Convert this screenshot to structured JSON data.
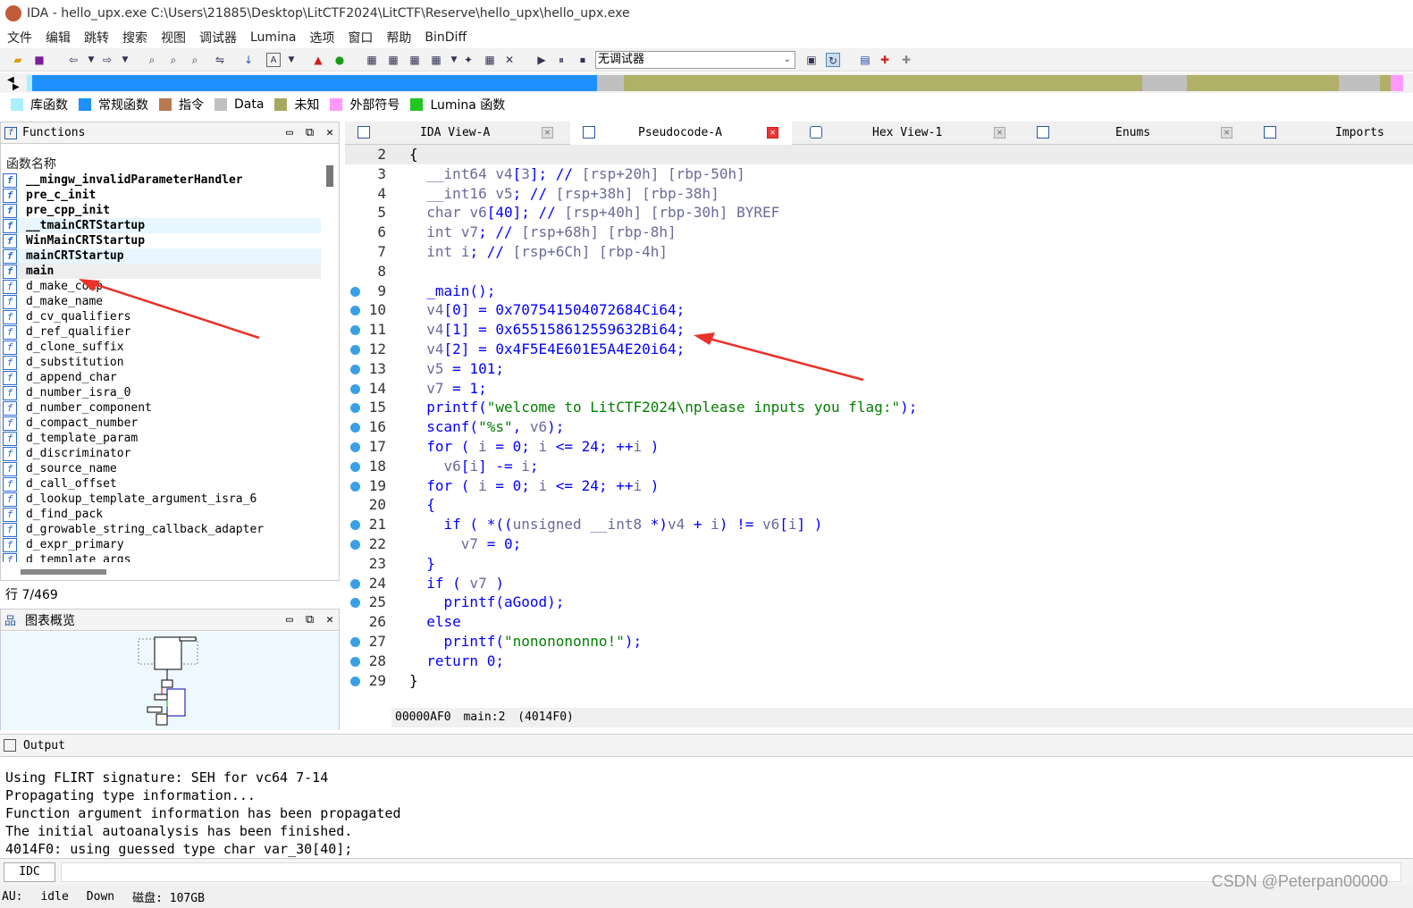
{
  "titlebar": {
    "title": "IDA - hello_upx.exe C:\\Users\\21885\\Desktop\\LitCTF2024\\LitCTF\\Reserve\\hello_upx\\hello_upx.exe"
  },
  "menu": [
    "文件",
    "编辑",
    "跳转",
    "搜索",
    "视图",
    "调试器",
    "Lumina",
    "选项",
    "窗口",
    "帮助",
    "BinDiff"
  ],
  "toolbar": {
    "debugger_select": "无调试器"
  },
  "legend": [
    {
      "label": "库函数",
      "color": "#aaeeff"
    },
    {
      "label": "常规函数",
      "color": "#1e90ff"
    },
    {
      "label": "指令",
      "color": "#b87850"
    },
    {
      "label": "Data",
      "color": "#c0c0c0"
    },
    {
      "label": "未知",
      "color": "#a8a860"
    },
    {
      "label": "外部符号",
      "color": "#ff99ff"
    },
    {
      "label": "Lumina 函数",
      "color": "#22c622"
    }
  ],
  "functions_panel": {
    "title": "Functions",
    "column_header": "函数名称",
    "items": [
      {
        "name": "__mingw_invalidParameterHandler",
        "style": "bold"
      },
      {
        "name": "pre_c_init",
        "style": "bold"
      },
      {
        "name": "pre_cpp_init",
        "style": "bold"
      },
      {
        "name": "__tmainCRTStartup",
        "style": "bold hl"
      },
      {
        "name": "WinMainCRTStartup",
        "style": "bold"
      },
      {
        "name": "mainCRTStartup",
        "style": "bold hl"
      },
      {
        "name": "main",
        "style": "bold sel"
      },
      {
        "name": "d_make_comp",
        "style": ""
      },
      {
        "name": "d_make_name",
        "style": ""
      },
      {
        "name": "d_cv_qualifiers",
        "style": ""
      },
      {
        "name": "d_ref_qualifier",
        "style": ""
      },
      {
        "name": "d_clone_suffix",
        "style": ""
      },
      {
        "name": "d_substitution",
        "style": ""
      },
      {
        "name": "d_append_char",
        "style": ""
      },
      {
        "name": "d_number_isra_0",
        "style": ""
      },
      {
        "name": "d_number_component",
        "style": ""
      },
      {
        "name": "d_compact_number",
        "style": ""
      },
      {
        "name": "d_template_param",
        "style": ""
      },
      {
        "name": "d_discriminator",
        "style": ""
      },
      {
        "name": "d_source_name",
        "style": ""
      },
      {
        "name": "d_call_offset",
        "style": ""
      },
      {
        "name": "d_lookup_template_argument_isra_6",
        "style": ""
      },
      {
        "name": "d_find_pack",
        "style": ""
      },
      {
        "name": "d_growable_string_callback_adapter",
        "style": ""
      },
      {
        "name": "d_expr_primary",
        "style": ""
      },
      {
        "name": "d_template_args",
        "style": ""
      }
    ],
    "row_info": "行 7/469"
  },
  "graph_panel": {
    "title": "图表概览"
  },
  "tabs": [
    {
      "label": "IDA View-A",
      "active": false
    },
    {
      "label": "Pseudocode-A",
      "active": true
    },
    {
      "label": "Hex View-1",
      "active": false
    },
    {
      "label": "Enums",
      "active": false
    },
    {
      "label": "Imports",
      "active": false
    }
  ],
  "code_lines": [
    {
      "n": "2",
      "dot": false,
      "html": "<span class='blk'>{</span>"
    },
    {
      "n": "3",
      "dot": false,
      "html": "  <span class='v'>__int64</span> <span class='v'>v4</span>[<span class='v'>3</span>]; <span class='k'>//</span> <span class='v'>[rsp+20h] [rbp-50h]</span>"
    },
    {
      "n": "4",
      "dot": false,
      "html": "  <span class='v'>__int16</span> <span class='v'>v5</span>; <span class='k'>//</span> <span class='v'>[rsp+38h] [rbp-38h]</span>"
    },
    {
      "n": "5",
      "dot": false,
      "html": "  <span class='v'>char</span> <span class='v'>v6</span>[40]; <span class='k'>//</span> <span class='v'>[rsp+40h] [rbp-30h] BYREF</span>"
    },
    {
      "n": "6",
      "dot": false,
      "html": "  <span class='v'>int</span> <span class='v'>v7</span>; <span class='k'>//</span> <span class='v'>[rsp+68h] [rbp-8h]</span>"
    },
    {
      "n": "7",
      "dot": false,
      "html": "  <span class='v'>int</span> <span class='v'>i</span>; <span class='k'>//</span> <span class='v'>[rsp+6Ch] [rbp-4h]</span>"
    },
    {
      "n": "8",
      "dot": false,
      "html": ""
    },
    {
      "n": "9",
      "dot": true,
      "html": "  _main();"
    },
    {
      "n": "10",
      "dot": true,
      "html": "  <span class='v'>v4</span>[0] = 0x707541504072684Ci64;"
    },
    {
      "n": "11",
      "dot": true,
      "html": "  <span class='v'>v4</span>[1] = 0x655158612559632Bi64;"
    },
    {
      "n": "12",
      "dot": true,
      "html": "  <span class='v'>v4</span>[2] = 0x4F5E4E601E5A4E20i64;"
    },
    {
      "n": "13",
      "dot": true,
      "html": "  <span class='v'>v5</span> = 101;"
    },
    {
      "n": "14",
      "dot": true,
      "html": "  <span class='v'>v7</span> = 1;"
    },
    {
      "n": "15",
      "dot": true,
      "html": "  printf(<span class='g'>\"welcome to LitCTF2024\\nplease inputs you flag:\"</span>);"
    },
    {
      "n": "16",
      "dot": true,
      "html": "  scanf(<span class='g'>\"%s\"</span>, <span class='v'>v6</span>);"
    },
    {
      "n": "17",
      "dot": true,
      "html": "  for ( <span class='v'>i</span> = 0; <span class='v'>i</span> &lt;= 24; ++<span class='v'>i</span> )"
    },
    {
      "n": "18",
      "dot": true,
      "html": "    <span class='v'>v6</span>[<span class='v'>i</span>] -= <span class='v'>i</span>;"
    },
    {
      "n": "19",
      "dot": true,
      "html": "  for ( <span class='v'>i</span> = 0; <span class='v'>i</span> &lt;= 24; ++<span class='v'>i</span> )"
    },
    {
      "n": "20",
      "dot": false,
      "html": "  {"
    },
    {
      "n": "21",
      "dot": true,
      "html": "    if ( *((<span class='v'>unsigned __int8</span> *)<span class='v'>v4</span> + <span class='v'>i</span>) != <span class='v'>v6</span>[<span class='v'>i</span>] )"
    },
    {
      "n": "22",
      "dot": true,
      "html": "      <span class='v'>v7</span> = 0;"
    },
    {
      "n": "23",
      "dot": false,
      "html": "  }"
    },
    {
      "n": "24",
      "dot": true,
      "html": "  if ( <span class='v'>v7</span> )"
    },
    {
      "n": "25",
      "dot": true,
      "html": "    printf(aGood);"
    },
    {
      "n": "26",
      "dot": false,
      "html": "  else"
    },
    {
      "n": "27",
      "dot": true,
      "html": "    printf(<span class='g'>\"nononononno!\"</span>);"
    },
    {
      "n": "28",
      "dot": true,
      "html": "  return 0;"
    },
    {
      "n": "29",
      "dot": true,
      "html": "<span class='blk'>}</span>"
    }
  ],
  "code_status": {
    "addr": "00000AF0",
    "func": "main:2",
    "ea": "(4014F0)"
  },
  "output": {
    "title": "Output",
    "lines": [
      "Using FLIRT signature: SEH for vc64 7-14",
      "Propagating type information...",
      "Function argument information has been propagated",
      "The initial autoanalysis has been finished.",
      "4014F0: using guessed type char var_30[40];"
    ]
  },
  "idc": {
    "button": "IDC"
  },
  "status": {
    "au": "AU:",
    "state": "idle",
    "dir": "Down",
    "disk": "磁盘: 107GB"
  },
  "watermark": "CSDN @Peterpan00000"
}
